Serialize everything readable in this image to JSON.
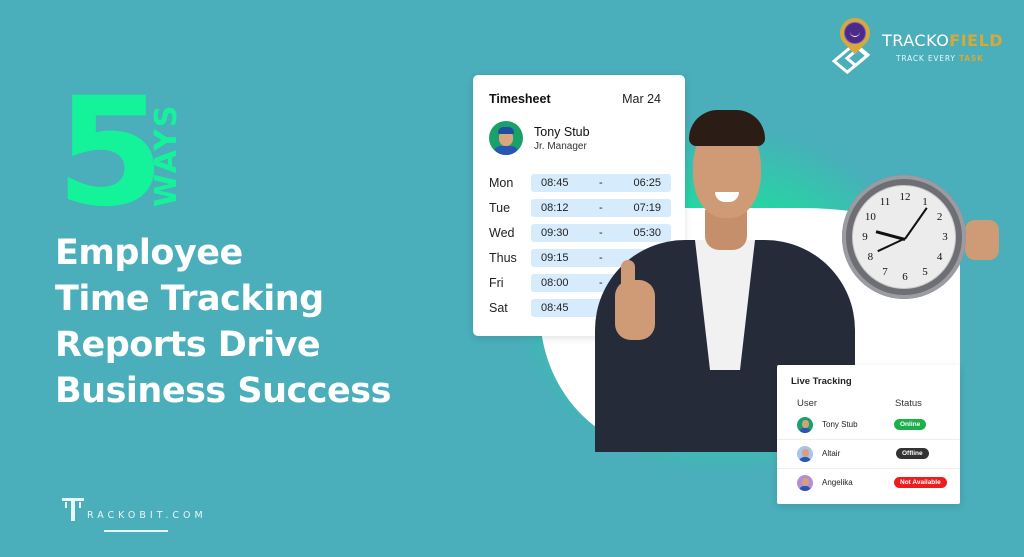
{
  "headline": {
    "number": "5",
    "ways": "WAYS",
    "lines": [
      "Employee",
      "Time Tracking",
      "Reports Drive",
      "Business Success"
    ]
  },
  "brand_trackobit": {
    "text": "RACKOBIT.COM",
    "icon": "trackobit-t-logo-icon"
  },
  "brand_trackofield": {
    "name_part1": "TRACKO",
    "name_part2": "FIELD",
    "tagline_part1": "TRACK EVERY ",
    "tagline_part2": "TASK",
    "icon": "map-pin-logo-icon"
  },
  "colors": {
    "background": "#4aaebb",
    "accent_green": "#15f39a",
    "gold": "#d5a93a",
    "pill_blue": "#d6ebfc",
    "status_online": "#19b24a",
    "status_offline": "#333333",
    "status_not_available": "#ee1d1d"
  },
  "timesheet": {
    "title": "Timesheet",
    "date": "Mar 24",
    "employee": {
      "name": "Tony Stub",
      "role": "Jr. Manager"
    },
    "rows": [
      {
        "day": "Mon",
        "in": "08:45",
        "sep": "-",
        "out": "06:25"
      },
      {
        "day": "Tue",
        "in": "08:12",
        "sep": "-",
        "out": "07:19"
      },
      {
        "day": "Wed",
        "in": "09:30",
        "sep": "-",
        "out": "05:30"
      },
      {
        "day": "Thus",
        "in": "09:15",
        "sep": "-",
        "out": ""
      },
      {
        "day": "Fri",
        "in": "08:00",
        "sep": "-",
        "out": ""
      },
      {
        "day": "Sat",
        "in": "08:45",
        "sep": "-",
        "out": ""
      }
    ]
  },
  "clock": {
    "numbers": [
      "12",
      "1",
      "2",
      "3",
      "4",
      "5",
      "6",
      "7",
      "8",
      "9",
      "10",
      "11"
    ]
  },
  "live_tracking": {
    "title": "Live Tracking",
    "col_user": "User",
    "col_status": "Status",
    "rows": [
      {
        "user": "Tony Stub",
        "status": "Online",
        "status_color": "#19b24a",
        "avatar_bg": "#1aa06a"
      },
      {
        "user": "Altair",
        "status": "Offline",
        "status_color": "#333333",
        "avatar_bg": "#a9c3ee"
      },
      {
        "user": "Angelika",
        "status": "Not Available",
        "status_color": "#ee1d1d",
        "avatar_bg": "#b58fd6"
      }
    ]
  }
}
